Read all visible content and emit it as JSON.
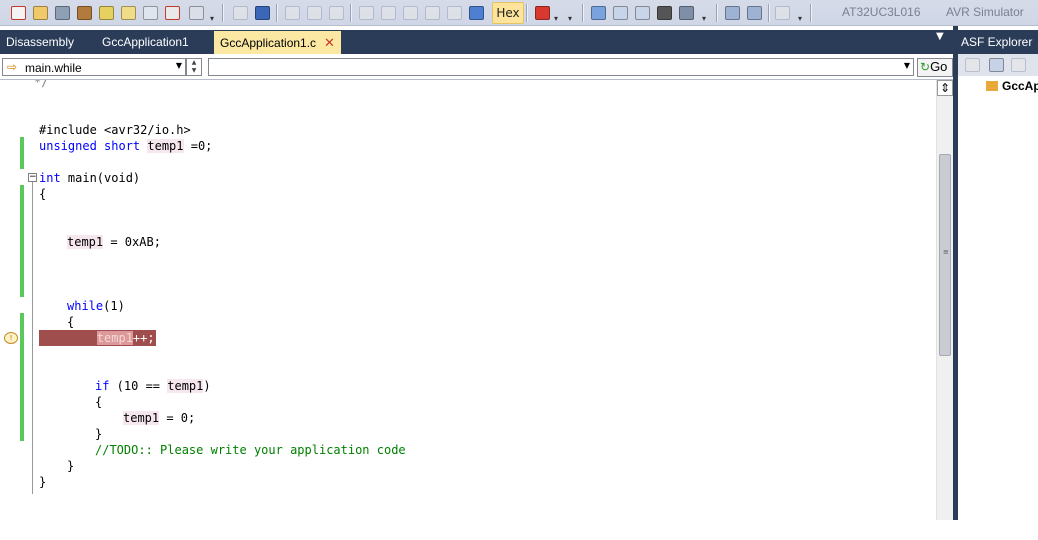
{
  "toolbar": {
    "hex_label": "Hex",
    "device_label": "AT32UC3L016",
    "tool_label": "AVR Simulator",
    "icons": [
      "checkbox-icon",
      "open-icon",
      "wrench-icon",
      "tools-icon",
      "tag-icon",
      "tag2-icon",
      "braces-icon",
      "spellcheck-icon",
      "paste-icon",
      "play-pause-icon",
      "stop-icon",
      "step-icon",
      "pause-icon",
      "run-icon",
      "step-over-icon",
      "step-into-icon",
      "step-out-icon",
      "run-to-icon",
      "step-return-icon",
      "stop-debug-icon",
      "record-icon",
      "layout-icon",
      "memory-icon",
      "registers-icon",
      "processor-icon",
      "disassembly-icon",
      "calendar-icon",
      "watch-icon",
      "tool-icon"
    ]
  },
  "tabs": [
    {
      "label": "Disassembly",
      "active": false
    },
    {
      "label": "GccApplication1",
      "active": false
    },
    {
      "label": "GccApplication1.c",
      "active": true
    }
  ],
  "navbar": {
    "scope_value": "main.while",
    "address_value": "",
    "go_label": "Go"
  },
  "code": {
    "lines": [
      {
        "text": "#include <avr32/io.h>"
      },
      {
        "kw": "unsigned short ",
        "var": "temp1",
        "rest": " =0;"
      },
      {
        "kw": "int",
        "rest": " main(void)"
      },
      {
        "rest": "{"
      },
      {
        "var": "temp1",
        "rest": " = 0xAB;"
      },
      {
        "kw": "while",
        "rest": "(1)"
      },
      {
        "rest": "{"
      },
      {
        "hl_pre": "        ",
        "hl_var": "temp1",
        "hl_post": "++;"
      },
      {
        "kw": "if",
        "rest": " (10 == ",
        "var": "temp1",
        "rest2": ")"
      },
      {
        "rest": "{"
      },
      {
        "var": "temp1",
        "rest": " = 0;"
      },
      {
        "rest": "}"
      },
      {
        "comment": "//TODO:: Please write your application code"
      },
      {
        "rest": "}"
      },
      {
        "rest": "}"
      }
    ],
    "top_fragment": "*/"
  },
  "asf": {
    "title": "ASF Explorer",
    "item": "GccAp"
  },
  "colors": {
    "tab_bg": "#2b3c59",
    "active_tab": "#fbe9a3",
    "change_marker": "#5ac85a",
    "current_line": "#9f4d4d",
    "keyword": "#0000ff",
    "comment": "#008000"
  }
}
